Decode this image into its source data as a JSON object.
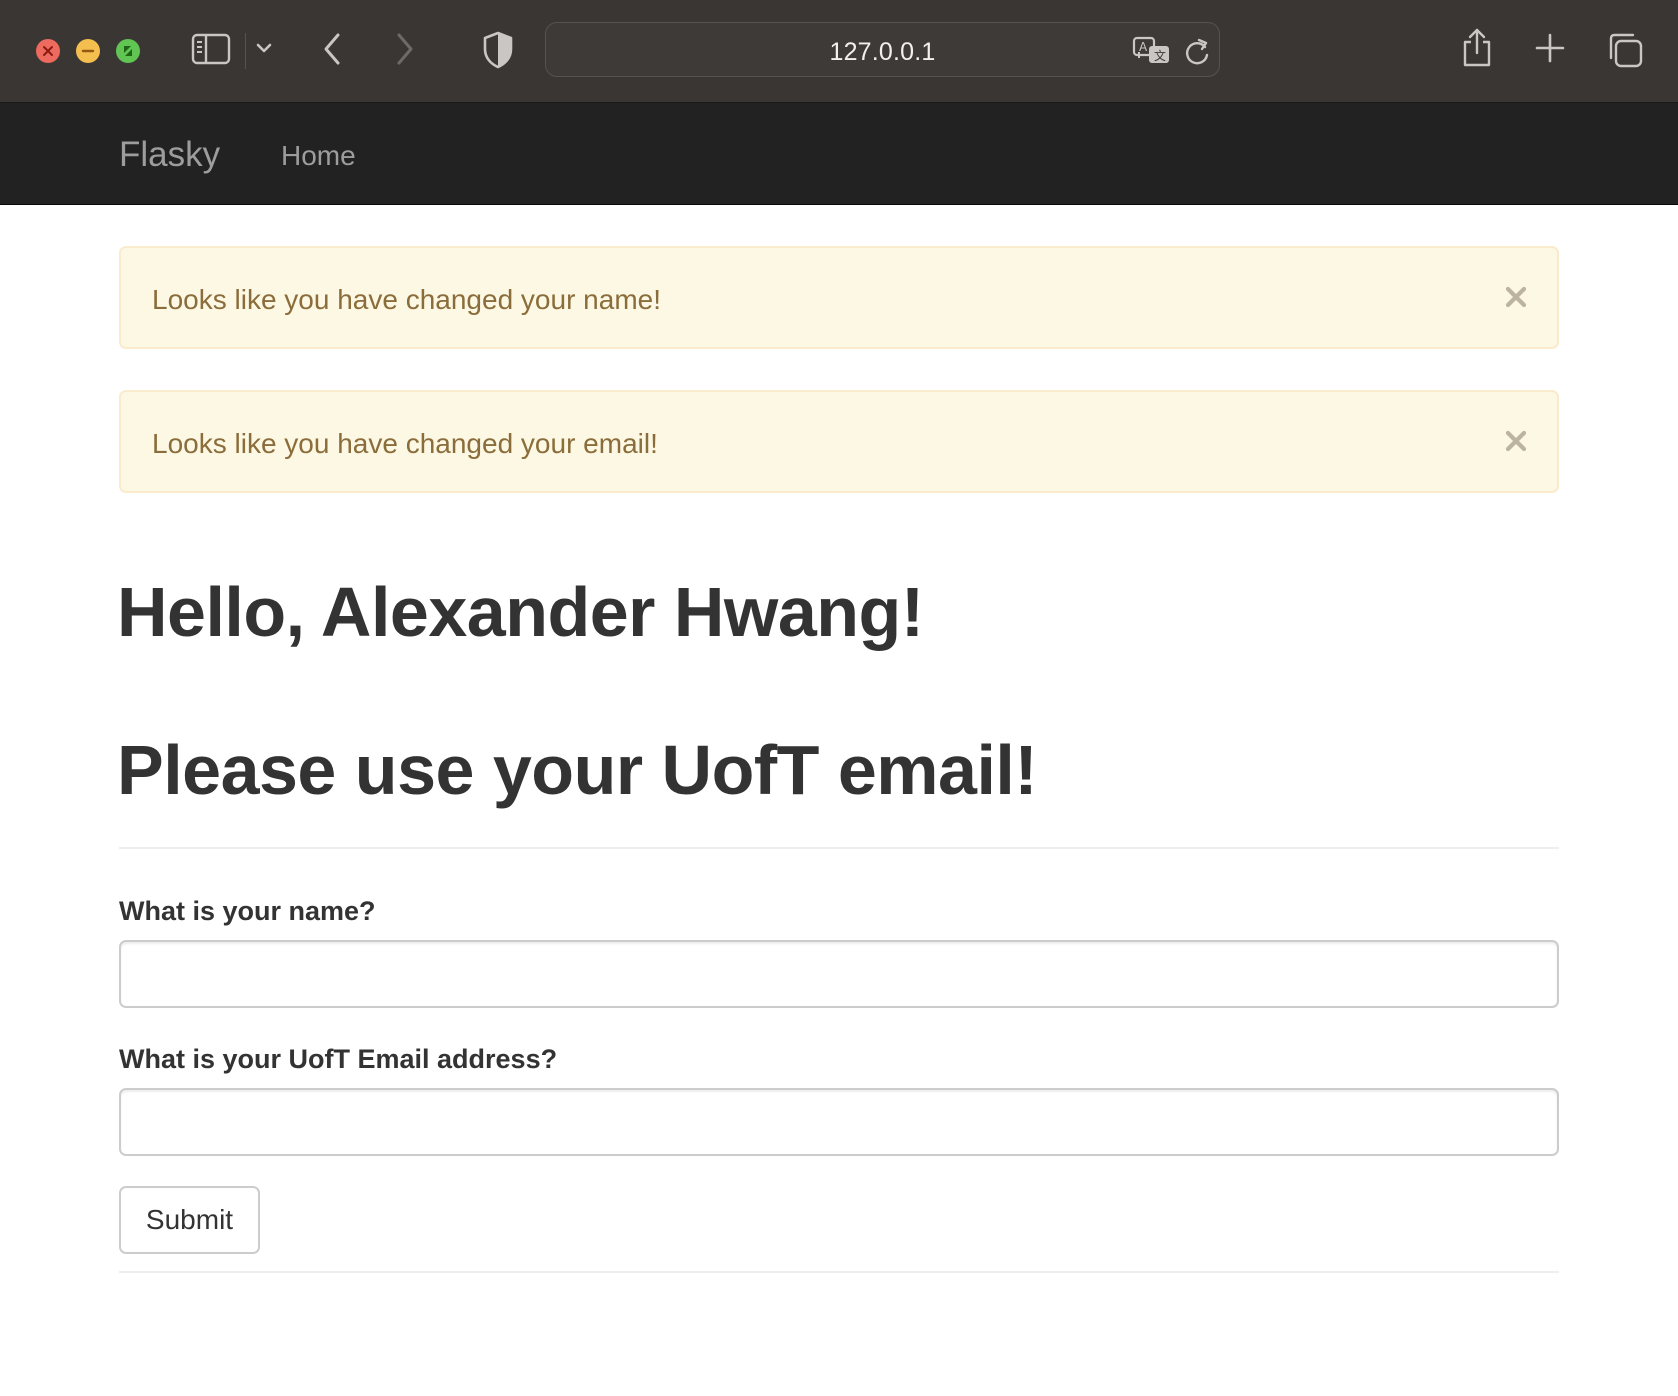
{
  "browser": {
    "url": "127.0.0.1"
  },
  "navbar": {
    "brand": "Flasky",
    "home_label": "Home"
  },
  "alerts": [
    {
      "message": "Looks like you have changed your name!",
      "close_label": "×"
    },
    {
      "message": "Looks like you have changed your email!",
      "close_label": "×"
    }
  ],
  "main": {
    "greeting": "Hello, Alexander Hwang!",
    "heading": "Please use your UofT email!"
  },
  "form": {
    "name_label": "What is your name?",
    "name_value": "",
    "email_label": "What is your UofT Email address?",
    "email_value": "",
    "submit_label": "Submit"
  },
  "colors": {
    "navbar_bg": "#222222",
    "alert_bg": "#fcf8e3",
    "alert_text": "#8a6d3b",
    "heading_text": "#333333"
  }
}
